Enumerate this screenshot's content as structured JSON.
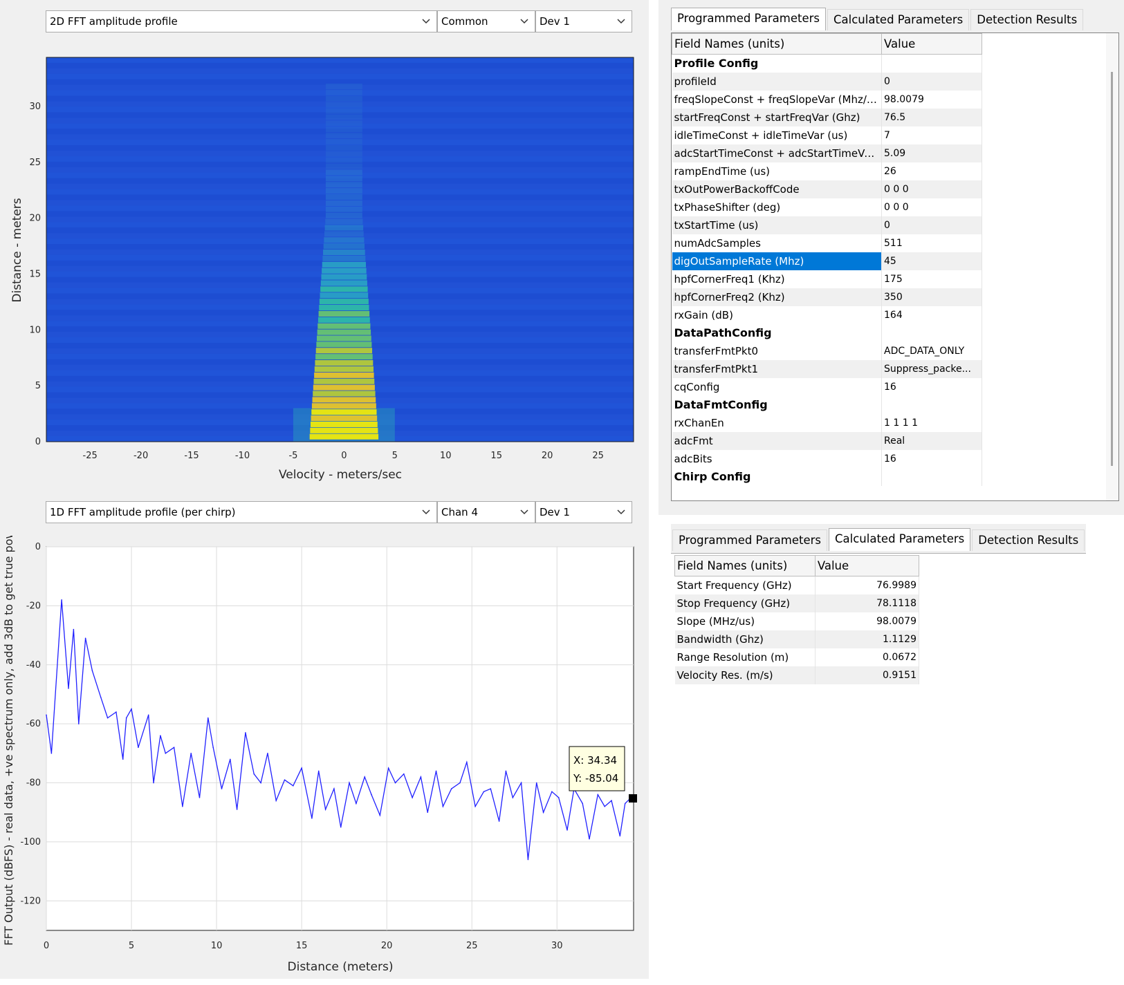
{
  "top_plot": {
    "view_select": "2D FFT amplitude profile",
    "channel_select": "Common",
    "device_select": "Dev 1",
    "ylabel": "Distance - meters",
    "xlabel": "Velocity - meters/sec",
    "xticks": [
      "-25",
      "-20",
      "-15",
      "-10",
      "-5",
      "0",
      "5",
      "10",
      "15",
      "20",
      "25"
    ],
    "yticks": [
      "0",
      "5",
      "10",
      "15",
      "20",
      "25",
      "30"
    ],
    "colors": {
      "background": "#1e4fd6",
      "peak": "#fff000",
      "mid": "#27c1a6"
    }
  },
  "bottom_plot": {
    "view_select": "1D FFT amplitude profile (per chirp)",
    "channel_select": "Chan 4",
    "device_select": "Dev 1",
    "ylabel": "FFT Output (dBFS) - real data, +ve spectrum only, add 3dB to get true power",
    "xlabel": "Distance (meters)",
    "xticks": [
      "0",
      "5",
      "10",
      "15",
      "20",
      "25",
      "30"
    ],
    "yticks": [
      "0",
      "-20",
      "-40",
      "-60",
      "-80",
      "-100",
      "-120"
    ],
    "datatip": {
      "x_label": "X: 34.34",
      "y_label": "Y: -85.04"
    },
    "line_color": "#2020ff"
  },
  "chart_data": {
    "type": "line",
    "title": "",
    "xlabel": "Distance (meters)",
    "ylabel": "FFT Output (dBFS) - real data, +ve spectrum only, add 3dB to get true power",
    "xlim": [
      0,
      34.5
    ],
    "ylim": [
      -130,
      0
    ],
    "grid": true,
    "series": [
      {
        "x": [
          0,
          0.3,
          0.9,
          1.3,
          1.6,
          1.9,
          2.3,
          2.7,
          3.2,
          3.6,
          4.1,
          4.5,
          4.7,
          5.0,
          5.4,
          6.0,
          6.3,
          6.7,
          7.0,
          7.5,
          8.0,
          8.5,
          9.0,
          9.5,
          9.8,
          10.3,
          10.8,
          11.2,
          11.7,
          12.2,
          12.6,
          13.0,
          13.5,
          14.0,
          14.5,
          15.0,
          15.6,
          16.0,
          16.4,
          16.9,
          17.3,
          17.8,
          18.2,
          18.7,
          19.1,
          19.6,
          20.1,
          20.5,
          21.0,
          21.5,
          22.0,
          22.4,
          22.9,
          23.3,
          23.8,
          24.3,
          24.7,
          25.2,
          25.7,
          26.1,
          26.6,
          27.0,
          27.4,
          27.9,
          28.3,
          28.8,
          29.2,
          29.7,
          30.1,
          30.6,
          31.0,
          31.5,
          31.9,
          32.4,
          32.8,
          33.2,
          33.7,
          34.0,
          34.34
        ],
        "y": [
          -57,
          -70,
          -18,
          -48,
          -28,
          -60,
          -31,
          -42,
          -51,
          -58,
          -56,
          -72,
          -58,
          -55,
          -68,
          -57,
          -80,
          -64,
          -70,
          -68,
          -88,
          -70,
          -85,
          -58,
          -68,
          -82,
          -72,
          -89,
          -63,
          -77,
          -80,
          -70,
          -86,
          -79,
          -81,
          -75,
          -92,
          -76,
          -89,
          -82,
          -95,
          -80,
          -87,
          -78,
          -84,
          -91,
          -75,
          -80,
          -77,
          -85,
          -78,
          -90,
          -76,
          -88,
          -82,
          -80,
          -73,
          -88,
          -83,
          -82,
          -93,
          -76,
          -85,
          -80,
          -106,
          -80,
          -90,
          -83,
          -85,
          -96,
          -82,
          -87,
          -99,
          -84,
          -88,
          -86,
          -98,
          -87,
          -85.04
        ]
      }
    ]
  },
  "programmed_panel": {
    "tabs": [
      "Programmed Parameters",
      "Calculated Parameters",
      "Detection Results"
    ],
    "active_tab": 0,
    "col_name": "Field Names  (units)",
    "col_value": "Value",
    "rows": [
      {
        "type": "group",
        "name": "Profile Config",
        "value": ""
      },
      {
        "type": "row",
        "name": "profileId",
        "value": "0"
      },
      {
        "type": "row",
        "name": "freqSlopeConst + freqSlopeVar (Mhz/us)",
        "value": "98.0079"
      },
      {
        "type": "row",
        "name": "startFreqConst + startFreqVar (Ghz)",
        "value": "76.5"
      },
      {
        "type": "row",
        "name": "idleTimeConst + idleTimeVar (us)",
        "value": "7"
      },
      {
        "type": "row",
        "name": "adcStartTimeConst + adcStartTimeVar (...",
        "value": "5.09"
      },
      {
        "type": "row",
        "name": "rampEndTime (us)",
        "value": "26"
      },
      {
        "type": "row",
        "name": "txOutPowerBackoffCode",
        "value": "0 0 0"
      },
      {
        "type": "row",
        "name": "txPhaseShifter (deg)",
        "value": "0 0 0"
      },
      {
        "type": "row",
        "name": "txStartTime (us)",
        "value": "0"
      },
      {
        "type": "row",
        "name": "numAdcSamples",
        "value": "511"
      },
      {
        "type": "row",
        "name": "digOutSampleRate (Mhz)",
        "value": "45",
        "selected": true
      },
      {
        "type": "row",
        "name": "hpfCornerFreq1 (Khz)",
        "value": "175"
      },
      {
        "type": "row",
        "name": "hpfCornerFreq2 (Khz)",
        "value": "350"
      },
      {
        "type": "row",
        "name": "rxGain (dB)",
        "value": "164"
      },
      {
        "type": "group",
        "name": "DataPathConfig",
        "value": ""
      },
      {
        "type": "row",
        "name": "transferFmtPkt0",
        "value": "ADC_DATA_ONLY"
      },
      {
        "type": "row",
        "name": "transferFmtPkt1",
        "value": "Suppress_packe..."
      },
      {
        "type": "row",
        "name": "cqConfig",
        "value": "16"
      },
      {
        "type": "group",
        "name": "DataFmtConfig",
        "value": ""
      },
      {
        "type": "row",
        "name": "rxChanEn",
        "value": "1 1 1 1"
      },
      {
        "type": "row",
        "name": "adcFmt",
        "value": "Real"
      },
      {
        "type": "row",
        "name": "adcBits",
        "value": "16"
      },
      {
        "type": "group",
        "name": "Chirp Config",
        "value": ""
      }
    ]
  },
  "calculated_panel": {
    "tabs": [
      "Programmed Parameters",
      "Calculated Parameters",
      "Detection Results"
    ],
    "active_tab": 1,
    "col_name": "Field Names  (units)",
    "col_value": "Value",
    "rows": [
      {
        "name": "Start Frequency (GHz)",
        "value": "76.9989"
      },
      {
        "name": "Stop Frequency (GHz)",
        "value": "78.1118"
      },
      {
        "name": "Slope (MHz/us)",
        "value": "98.0079"
      },
      {
        "name": "Bandwidth (Ghz)",
        "value": "1.1129"
      },
      {
        "name": "Range Resolution (m)",
        "value": "0.0672"
      },
      {
        "name": "Velocity Res. (m/s)",
        "value": "0.9151"
      }
    ]
  }
}
